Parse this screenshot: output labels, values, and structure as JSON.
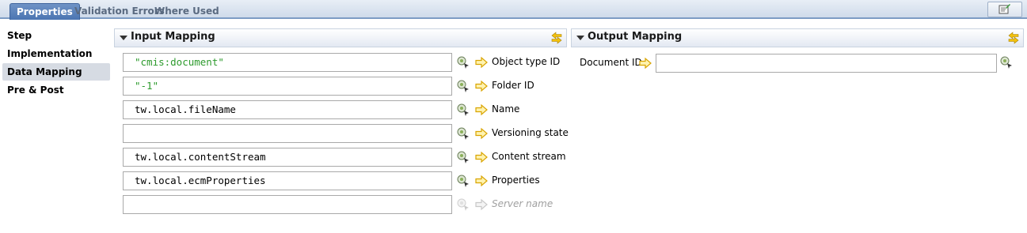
{
  "tabs": [
    "Properties",
    "Validation Errors",
    "Where Used"
  ],
  "nav": [
    "Step",
    "Implementation",
    "Data Mapping",
    "Pre & Post"
  ],
  "input_panel": {
    "title": "Input Mapping"
  },
  "output_panel": {
    "title": "Output Mapping"
  },
  "input_rows": [
    {
      "value": "\"cmis:document\"",
      "label": "Object type ID"
    },
    {
      "value": "\"-1\"",
      "label": "Folder ID"
    },
    {
      "value": "tw.local.fileName",
      "label": "Name"
    },
    {
      "value": "",
      "label": "Versioning state"
    },
    {
      "value": "tw.local.contentStream",
      "label": "Content stream"
    },
    {
      "value": "tw.local.ecmProperties",
      "label": "Properties"
    },
    {
      "value": "",
      "label": "Server name"
    }
  ],
  "output_rows": [
    {
      "label": "Document ID",
      "value": ""
    }
  ],
  "colors": {
    "tab_active": "#4b75b2",
    "string_literal": "#2c9a2c",
    "arrow": "#e8b400"
  }
}
